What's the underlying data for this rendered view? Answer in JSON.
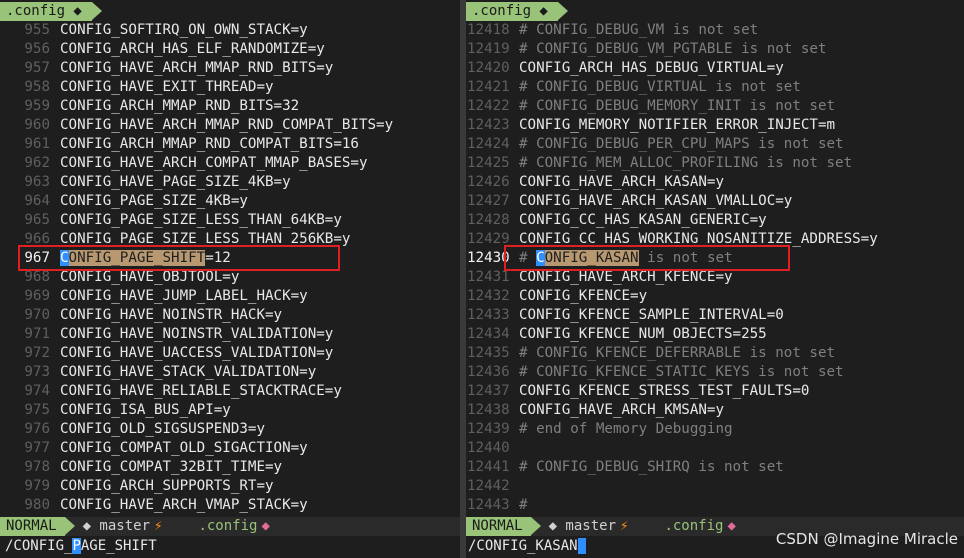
{
  "left_pane": {
    "tab_title": ".config ◆",
    "lines": [
      {
        "num": "955",
        "text": "CONFIG_SOFTIRQ_ON_OWN_STACK=y"
      },
      {
        "num": "956",
        "text": "CONFIG_ARCH_HAS_ELF_RANDOMIZE=y"
      },
      {
        "num": "957",
        "text": "CONFIG_HAVE_ARCH_MMAP_RND_BITS=y"
      },
      {
        "num": "958",
        "text": "CONFIG_HAVE_EXIT_THREAD=y"
      },
      {
        "num": "959",
        "text": "CONFIG_ARCH_MMAP_RND_BITS=32"
      },
      {
        "num": "960",
        "text": "CONFIG_HAVE_ARCH_MMAP_RND_COMPAT_BITS=y"
      },
      {
        "num": "961",
        "text": "CONFIG_ARCH_MMAP_RND_COMPAT_BITS=16"
      },
      {
        "num": "962",
        "text": "CONFIG_HAVE_ARCH_COMPAT_MMAP_BASES=y"
      },
      {
        "num": "963",
        "text": "CONFIG_HAVE_PAGE_SIZE_4KB=y"
      },
      {
        "num": "964",
        "text": "CONFIG_PAGE_SIZE_4KB=y"
      },
      {
        "num": "965",
        "text": "CONFIG_PAGE_SIZE_LESS_THAN_64KB=y"
      },
      {
        "num": "966",
        "text": "CONFIG_PAGE_SIZE_LESS_THAN_256KB=y"
      },
      {
        "num": "967",
        "text": "CONFIG_PAGE_SHIFT=12"
      },
      {
        "num": "968",
        "text": "CONFIG_HAVE_OBJTOOL=y"
      },
      {
        "num": "969",
        "text": "CONFIG_HAVE_JUMP_LABEL_HACK=y"
      },
      {
        "num": "970",
        "text": "CONFIG_HAVE_NOINSTR_HACK=y"
      },
      {
        "num": "971",
        "text": "CONFIG_HAVE_NOINSTR_VALIDATION=y"
      },
      {
        "num": "972",
        "text": "CONFIG_HAVE_UACCESS_VALIDATION=y"
      },
      {
        "num": "973",
        "text": "CONFIG_HAVE_STACK_VALIDATION=y"
      },
      {
        "num": "974",
        "text": "CONFIG_HAVE_RELIABLE_STACKTRACE=y"
      },
      {
        "num": "975",
        "text": "CONFIG_ISA_BUS_API=y"
      },
      {
        "num": "976",
        "text": "CONFIG_OLD_SIGSUSPEND3=y"
      },
      {
        "num": "977",
        "text": "CONFIG_COMPAT_OLD_SIGACTION=y"
      },
      {
        "num": "978",
        "text": "CONFIG_COMPAT_32BIT_TIME=y"
      },
      {
        "num": "979",
        "text": "CONFIG_ARCH_SUPPORTS_RT=y"
      },
      {
        "num": "980",
        "text": "CONFIG_HAVE_ARCH_VMAP_STACK=y"
      }
    ],
    "current": {
      "cursor": "C",
      "match": "ONFIG_PAGE_SHIFT",
      "rest": "=12"
    },
    "status": {
      "mode": "NORMAL",
      "branch": "◆ master",
      "bolt": "⚡",
      "file": ".config",
      "diamond": "◆"
    },
    "cmd": {
      "before": "/CONFIG_",
      "cursor": "P",
      "after": "AGE_SHIFT"
    }
  },
  "right_pane": {
    "tab_title": ".config ◆",
    "lines": [
      {
        "num": "12418",
        "text": "# CONFIG_DEBUG_VM is not set",
        "comment": true
      },
      {
        "num": "12419",
        "text": "# CONFIG_DEBUG_VM_PGTABLE is not set",
        "comment": true
      },
      {
        "num": "12420",
        "text": "CONFIG_ARCH_HAS_DEBUG_VIRTUAL=y",
        "comment": false
      },
      {
        "num": "12421",
        "text": "# CONFIG_DEBUG_VIRTUAL is not set",
        "comment": true
      },
      {
        "num": "12422",
        "text": "# CONFIG_DEBUG_MEMORY_INIT is not set",
        "comment": true
      },
      {
        "num": "12423",
        "text": "CONFIG_MEMORY_NOTIFIER_ERROR_INJECT=m",
        "comment": false
      },
      {
        "num": "12424",
        "text": "# CONFIG_DEBUG_PER_CPU_MAPS is not set",
        "comment": true
      },
      {
        "num": "12425",
        "text": "# CONFIG_MEM_ALLOC_PROFILING is not set",
        "comment": true
      },
      {
        "num": "12426",
        "text": "CONFIG_HAVE_ARCH_KASAN=y",
        "comment": false
      },
      {
        "num": "12427",
        "text": "CONFIG_HAVE_ARCH_KASAN_VMALLOC=y",
        "comment": false
      },
      {
        "num": "12428",
        "text": "CONFIG_CC_HAS_KASAN_GENERIC=y",
        "comment": false
      },
      {
        "num": "12429",
        "text": "CONFIG_CC_HAS_WORKING_NOSANITIZE_ADDRESS=y",
        "comment": false
      },
      {
        "num": "12430",
        "text": "# CONFIG_KASAN is not set",
        "comment": true
      },
      {
        "num": "12431",
        "text": "CONFIG_HAVE_ARCH_KFENCE=y",
        "comment": false
      },
      {
        "num": "12432",
        "text": "CONFIG_KFENCE=y",
        "comment": false
      },
      {
        "num": "12433",
        "text": "CONFIG_KFENCE_SAMPLE_INTERVAL=0",
        "comment": false
      },
      {
        "num": "12434",
        "text": "CONFIG_KFENCE_NUM_OBJECTS=255",
        "comment": false
      },
      {
        "num": "12435",
        "text": "# CONFIG_KFENCE_DEFERRABLE is not set",
        "comment": true
      },
      {
        "num": "12436",
        "text": "# CONFIG_KFENCE_STATIC_KEYS is not set",
        "comment": true
      },
      {
        "num": "12437",
        "text": "CONFIG_KFENCE_STRESS_TEST_FAULTS=0",
        "comment": false
      },
      {
        "num": "12438",
        "text": "CONFIG_HAVE_ARCH_KMSAN=y",
        "comment": false
      },
      {
        "num": "12439",
        "text": "# end of Memory Debugging",
        "comment": true
      },
      {
        "num": "12440",
        "text": "",
        "comment": true
      },
      {
        "num": "12441",
        "text": "# CONFIG_DEBUG_SHIRQ is not set",
        "comment": true
      },
      {
        "num": "12442",
        "text": "",
        "comment": true
      },
      {
        "num": "12443",
        "text": "#",
        "comment": true
      }
    ],
    "current": {
      "hash": "# ",
      "cursor": "C",
      "match": "ONFIG_KASAN",
      "rest": " is not set"
    },
    "status": {
      "mode": "NORMAL",
      "branch": "◆ master",
      "bolt": "⚡",
      "file": ".config",
      "diamond": "◆"
    },
    "cmd": {
      "text": "/CONFIG_KASAN"
    }
  },
  "watermark": "CSDN @Imagine Miracle",
  "colors": {
    "accent_green": "#98c379",
    "cursor_blue": "#2f8fff",
    "highlight_red": "#e02020",
    "search_match": "#b89870"
  }
}
